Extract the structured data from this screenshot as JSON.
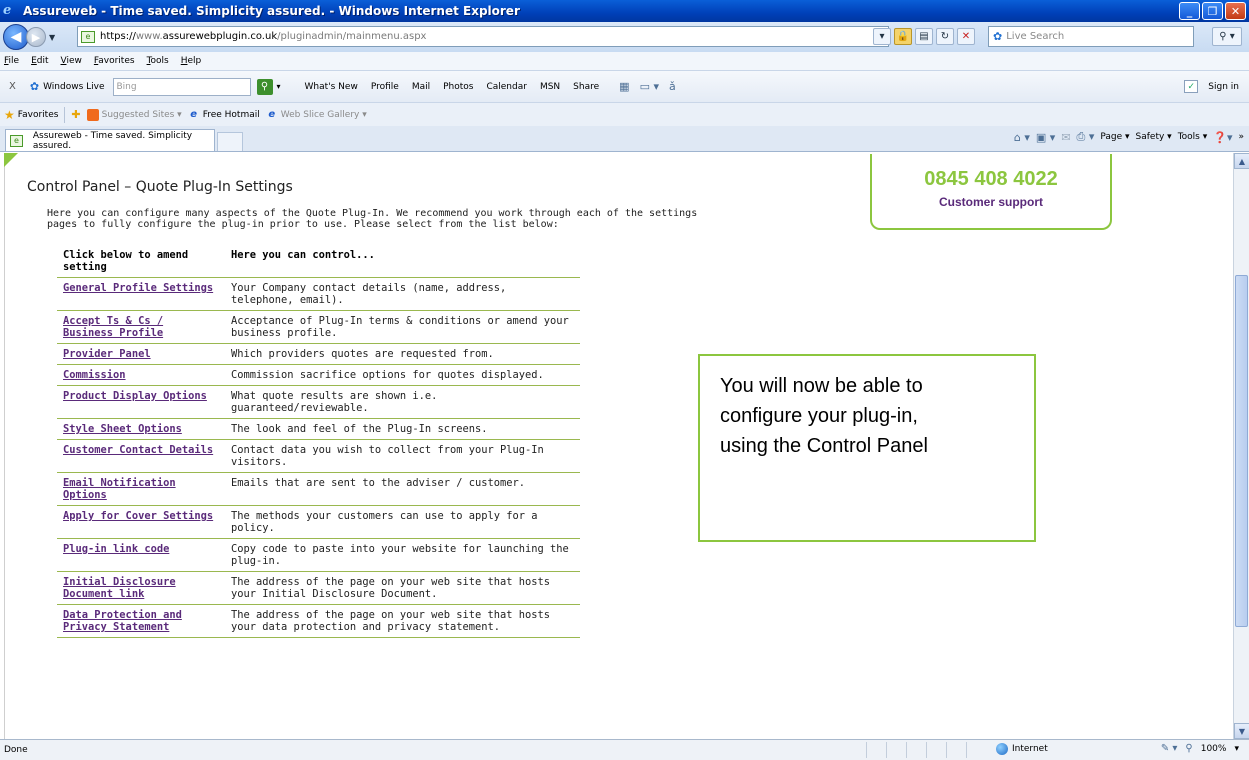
{
  "window": {
    "title": "Assureweb - Time saved. Simplicity assured. - Windows Internet Explorer",
    "minimize_icon": "minimize-icon",
    "restore_icon": "restore-icon",
    "close_icon": "close-icon"
  },
  "address": {
    "url_prefix": "https://",
    "url_host_pre": "www.",
    "url_host": "assurewebplugin.co.uk",
    "url_path": "/pluginadmin/mainmenu.aspx",
    "search_placeholder": "Live Search"
  },
  "menu": [
    "File",
    "Edit",
    "View",
    "Favorites",
    "Tools",
    "Help"
  ],
  "live_toolbar": {
    "close_glyph": "X",
    "brand": "Windows Live",
    "search_placeholder": "Bing",
    "links": [
      "What's New",
      "Profile",
      "Mail",
      "Photos",
      "Calendar",
      "MSN",
      "Share"
    ],
    "sign_in": "Sign in"
  },
  "favorites_bar": {
    "label": "Favorites",
    "items": [
      "Suggested Sites ▾",
      "Free Hotmail",
      "Web Slice Gallery ▾"
    ]
  },
  "tab": {
    "title": "Assureweb - Time saved. Simplicity assured."
  },
  "command_bar": {
    "page": "Page ▾",
    "safety": "Safety ▾",
    "tools": "Tools ▾"
  },
  "page": {
    "title": "Control Panel – Quote Plug-In Settings",
    "intro_line1": "Here you can configure many aspects of the Quote Plug-In. We recommend you work through each of the settings",
    "intro_line2": "pages to fully configure the plug-in prior to use. Please select from the list below:",
    "table_header": {
      "col1": "Click below to amend setting",
      "col2": "Here you can control..."
    },
    "rows": [
      {
        "setting": "General Profile Settings",
        "description": "Your Company contact details (name, address, telephone, email)."
      },
      {
        "setting": "Accept Ts & Cs / Business Profile",
        "description": "Acceptance of Plug-In terms & conditions or amend your business profile."
      },
      {
        "setting": "Provider Panel",
        "description": "Which providers quotes are requested from."
      },
      {
        "setting": "Commission",
        "description": "Commission sacrifice options for quotes displayed."
      },
      {
        "setting": "Product Display Options",
        "description": "What quote results are shown i.e. guaranteed/reviewable."
      },
      {
        "setting": "Style Sheet Options",
        "description": "The look and feel of the Plug-In screens."
      },
      {
        "setting": "Customer Contact Details",
        "description": "Contact data you wish to collect from your Plug-In visitors."
      },
      {
        "setting": "Email Notification Options",
        "description": "Emails that are sent to the adviser / customer."
      },
      {
        "setting": "Apply for Cover Settings",
        "description": "The methods your customers can use to apply for a policy."
      },
      {
        "setting": "Plug-in link code",
        "description": "Copy code to paste into your website for launching the plug-in."
      },
      {
        "setting": "Initial Disclosure Document link",
        "description": "The address of the page on your web site that hosts your Initial Disclosure Document."
      },
      {
        "setting": "Data Protection and Privacy Statement",
        "description": "The address of the page on your web site that hosts your data protection and privacy statement."
      }
    ]
  },
  "support": {
    "phone": "0845 408 4022",
    "label": "Customer support"
  },
  "callout": {
    "text_line1": "You will now be able to",
    "text_line2": "configure your plug-in,",
    "text_line3": "using the Control Panel"
  },
  "status": {
    "text": "Done",
    "zone": "Internet",
    "zoom": "100%"
  },
  "colors": {
    "accent_green": "#8cc63f",
    "link_purple": "#5a2a7a",
    "title_blue": "#0a5fd8"
  }
}
